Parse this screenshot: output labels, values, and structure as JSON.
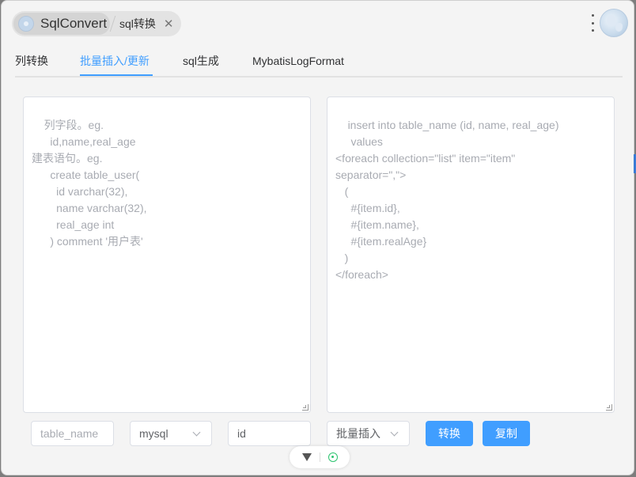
{
  "titlebar": {
    "app_name": "SqlConvert",
    "sub_title": "sql转换",
    "close_glyph": "✕"
  },
  "tabs": [
    {
      "label": "列转换",
      "active": false
    },
    {
      "label": "批量插入/更新",
      "active": true
    },
    {
      "label": "sql生成",
      "active": false
    },
    {
      "label": "MybatisLogFormat",
      "active": false
    }
  ],
  "editor": {
    "left_placeholder": "列字段。eg.\n      id,name,real_age\n建表语句。eg.\n      create table_user(\n        id varchar(32),\n        name varchar(32),\n        real_age int\n      ) comment '用户表'",
    "right_placeholder": "insert into table_name (id, name, real_age)\n     values\n<foreach collection=\"list\" item=\"item\"\nseparator=\",\">\n   (\n     #{item.id},\n     #{item.name},\n     #{item.realAge}\n   )\n</foreach>"
  },
  "controls": {
    "table_name_placeholder": "table_name",
    "db_type_value": "mysql",
    "id_field_value": "id",
    "mode_value": "批量插入",
    "convert_label": "转换",
    "copy_label": "复制"
  },
  "colors": {
    "accent": "#409eff",
    "placeholder": "#a8abb2"
  }
}
